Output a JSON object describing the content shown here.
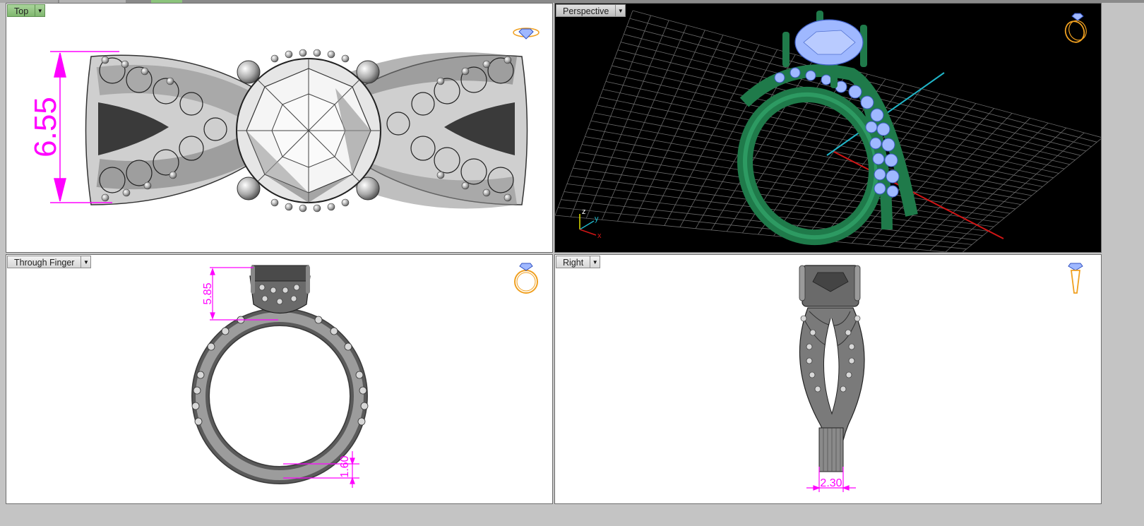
{
  "colors": {
    "dimension": "#ff00ff",
    "ring_green": "#1f7a4a",
    "gem_blue": "#9fb8ff",
    "grid": "#6a6a6a",
    "axis_red": "#d01515",
    "axis_cyan": "#20b5c8",
    "active_tab": "#8cc47c"
  },
  "viewports": {
    "top": {
      "label": "Top",
      "dimension": "6.55",
      "icon": "ring-top-icon"
    },
    "perspective": {
      "label": "Perspective",
      "icon": "ring-perspective-icon",
      "axes": {
        "z": "z",
        "y": "y",
        "x": "x"
      }
    },
    "through_finger": {
      "label": "Through Finger",
      "dimension_top": "5.85",
      "dimension_bottom": "1.60",
      "icon": "ring-front-icon"
    },
    "right": {
      "label": "Right",
      "dimension": "2.30",
      "icon": "ring-side-icon"
    }
  }
}
